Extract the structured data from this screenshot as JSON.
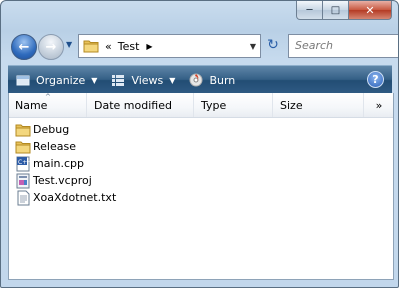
{
  "window": {
    "min_glyph": "─",
    "max_glyph": "□",
    "close_glyph": "✕"
  },
  "nav": {
    "back_glyph": "←",
    "forward_glyph": "→",
    "history_glyph": "▼",
    "address": {
      "separator": "«",
      "crumb": "Test",
      "crumb_arrow": "▶",
      "dropdown_glyph": "▼"
    },
    "refresh_glyph": "↻",
    "search_placeholder": "Search"
  },
  "toolbar": {
    "organize": "Organize",
    "views": "Views",
    "burn": "Burn",
    "dropdown_glyph": "▼",
    "help_glyph": "?"
  },
  "columns": {
    "name": "Name",
    "date": "Date modified",
    "type": "Type",
    "size": "Size",
    "more": "»",
    "sort_glyph": "^"
  },
  "files": [
    {
      "name": "Debug",
      "icon": "folder-icon"
    },
    {
      "name": "Release",
      "icon": "folder-icon"
    },
    {
      "name": "main.cpp",
      "icon": "cpp-file-icon"
    },
    {
      "name": "Test.vcproj",
      "icon": "vcproj-file-icon"
    },
    {
      "name": "XoaXdotnet.txt",
      "icon": "text-file-icon"
    }
  ],
  "colors": {
    "command_bar": "#345f86",
    "folder": "#e8c25a"
  }
}
